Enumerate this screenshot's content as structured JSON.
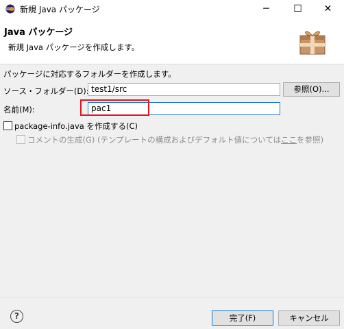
{
  "window": {
    "title": "新規 Java パッケージ",
    "minimize": "─",
    "maximize": "☐",
    "close": "✕"
  },
  "header": {
    "title": "Java パッケージ",
    "description": "新規 Java パッケージを作成します。"
  },
  "content": {
    "section_label": "パッケージに対応するフォルダーを作成します。",
    "source_folder_label": "ソース・フォルダー(D):",
    "source_folder_value": "test1/src",
    "browse_label": "参照(O)...",
    "name_label": "名前(M):",
    "name_value": "pac1",
    "create_package_info_label": "package-info.java を作成する(C)",
    "generate_comments_prefix": "コメントの生成(G) (テンプレートの構成およびデフォルト値については",
    "generate_comments_link": "ここ",
    "generate_comments_suffix": "を参照)"
  },
  "footer": {
    "help_icon": "?",
    "finish_label": "完了(F)",
    "cancel_label": "キャンセル"
  }
}
